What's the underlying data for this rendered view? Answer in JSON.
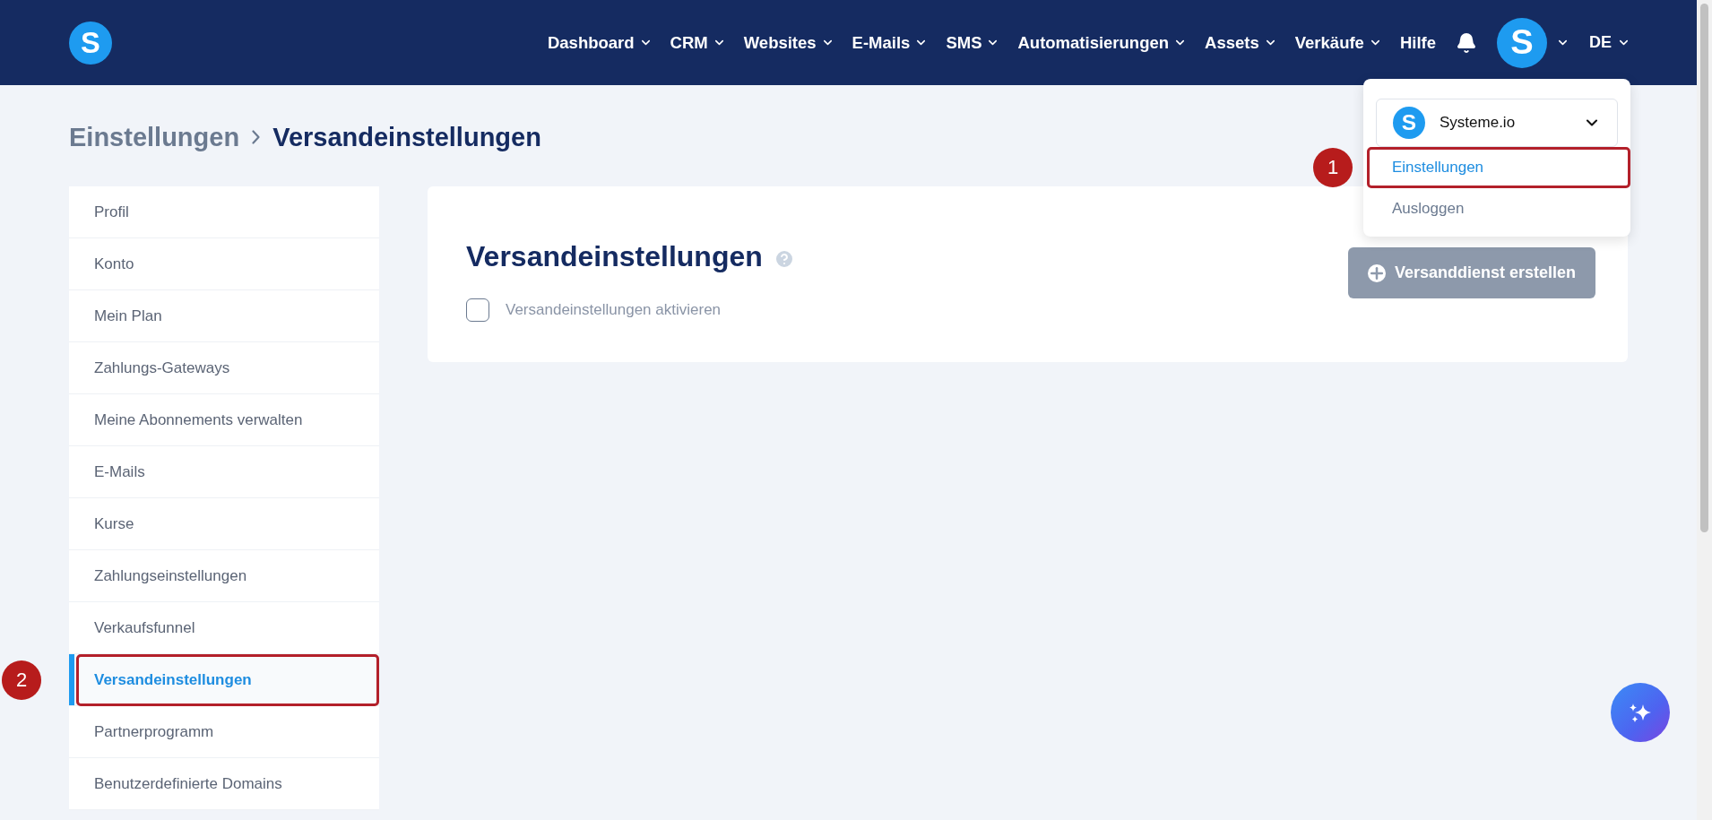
{
  "header": {
    "logo": "S",
    "nav": [
      {
        "label": "Dashboard",
        "has_menu": true
      },
      {
        "label": "CRM",
        "has_menu": true
      },
      {
        "label": "Websites",
        "has_menu": true
      },
      {
        "label": "E-Mails",
        "has_menu": true
      },
      {
        "label": "SMS",
        "has_menu": true
      },
      {
        "label": "Automatisierungen",
        "has_menu": true
      },
      {
        "label": "Assets",
        "has_menu": true
      },
      {
        "label": "Verkäufe",
        "has_menu": true
      },
      {
        "label": "Hilfe",
        "has_menu": false
      }
    ],
    "avatar": "S",
    "language": "DE"
  },
  "breadcrumb": [
    "Einstellungen",
    "Versandeinstellungen"
  ],
  "sidebar": {
    "items": [
      {
        "label": "Profil",
        "selected": false
      },
      {
        "label": "Konto",
        "selected": false
      },
      {
        "label": "Mein Plan",
        "selected": false
      },
      {
        "label": "Zahlungs-Gateways",
        "selected": false
      },
      {
        "label": "Meine Abonnements verwalten",
        "selected": false
      },
      {
        "label": "E-Mails",
        "selected": false
      },
      {
        "label": "Kurse",
        "selected": false
      },
      {
        "label": "Zahlungseinstellungen",
        "selected": false
      },
      {
        "label": "Verkaufsfunnel",
        "selected": false
      },
      {
        "label": "Versandeinstellungen",
        "selected": true,
        "callout": "2"
      },
      {
        "label": "Partnerprogramm",
        "selected": false
      },
      {
        "label": "Benutzerdefinierte Domains",
        "selected": false
      }
    ]
  },
  "card": {
    "title": "Versandeinstellungen",
    "checkbox": {
      "label": "Versandeinstellungen aktivieren",
      "checked": false
    },
    "create_button": {
      "label": "Versanddienst erstellen",
      "disabled": true
    }
  },
  "account_menu": {
    "logo": "S",
    "account": "Systeme.io",
    "items": [
      {
        "label": "Einstellungen",
        "selected": true,
        "callout": "1"
      },
      {
        "label": "Ausloggen",
        "selected": false
      }
    ]
  }
}
